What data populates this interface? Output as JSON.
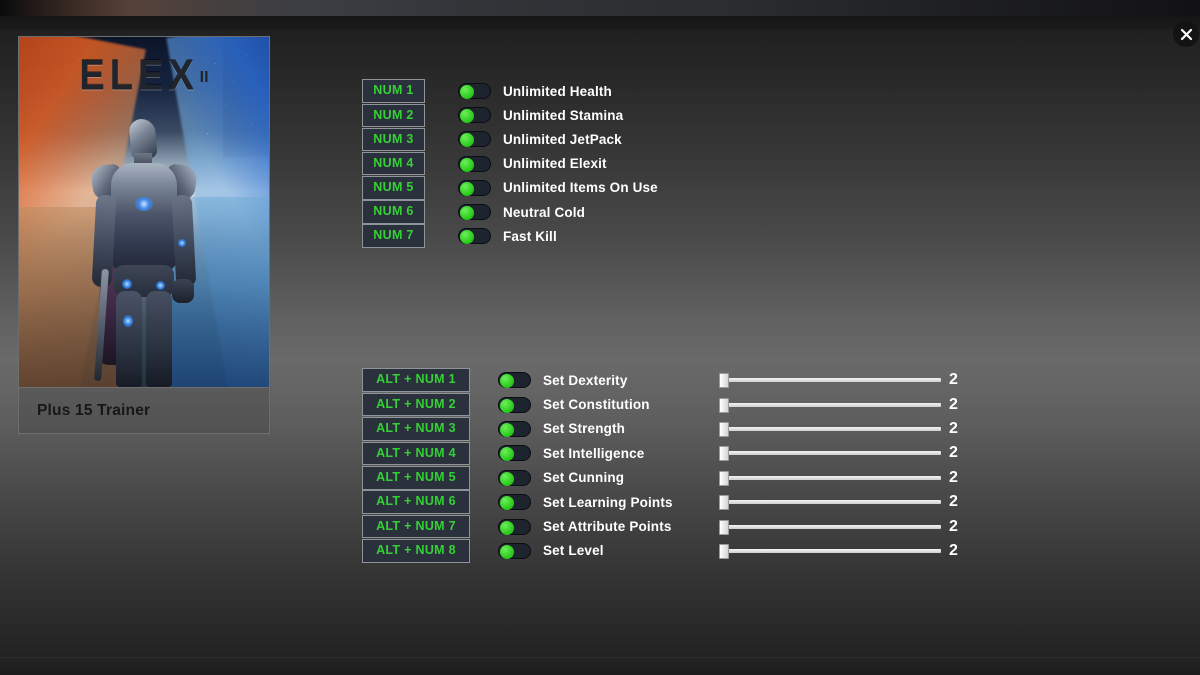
{
  "window": {
    "close_icon": "close-icon",
    "title": "ELEX II Trainer"
  },
  "cover": {
    "game_title": "ELEX",
    "game_title_suffix": "II",
    "caption": "Plus 15 Trainer"
  },
  "colors": {
    "hotkey_text": "#35d035",
    "hotkey_bg": "#2a313c",
    "hotkey_border": "#8f9499",
    "toggle_on": "#33cf23",
    "toggle_track": "#1d242e",
    "label_text": "#ffffff",
    "caption_text": "#171717",
    "slider_track": "#f4f4f4"
  },
  "cheats_basic": [
    {
      "hotkey": "NUM 1",
      "label": "Unlimited Health",
      "enabled": true
    },
    {
      "hotkey": "NUM 2",
      "label": "Unlimited Stamina",
      "enabled": true
    },
    {
      "hotkey": "NUM 3",
      "label": "Unlimited JetPack",
      "enabled": true
    },
    {
      "hotkey": "NUM 4",
      "label": "Unlimited Elexit",
      "enabled": true
    },
    {
      "hotkey": "NUM 5",
      "label": "Unlimited Items On Use",
      "enabled": true
    },
    {
      "hotkey": "NUM 6",
      "label": "Neutral Cold",
      "enabled": true
    },
    {
      "hotkey": "NUM 7",
      "label": "Fast Kill",
      "enabled": true
    }
  ],
  "cheats_stats": [
    {
      "hotkey": "ALT + NUM 1",
      "label": "Set Dexterity",
      "enabled": true,
      "value": "2"
    },
    {
      "hotkey": "ALT + NUM 2",
      "label": "Set Constitution",
      "enabled": true,
      "value": "2"
    },
    {
      "hotkey": "ALT + NUM 3",
      "label": "Set Strength",
      "enabled": true,
      "value": "2"
    },
    {
      "hotkey": "ALT + NUM 4",
      "label": "Set Intelligence",
      "enabled": true,
      "value": "2"
    },
    {
      "hotkey": "ALT + NUM 5",
      "label": "Set Cunning",
      "enabled": true,
      "value": "2"
    },
    {
      "hotkey": "ALT + NUM 6",
      "label": "Set Learning Points",
      "enabled": true,
      "value": "2"
    },
    {
      "hotkey": "ALT + NUM 7",
      "label": "Set Attribute Points",
      "enabled": true,
      "value": "2"
    },
    {
      "hotkey": "ALT + NUM 8",
      "label": "Set Level",
      "enabled": true,
      "value": "2"
    }
  ]
}
